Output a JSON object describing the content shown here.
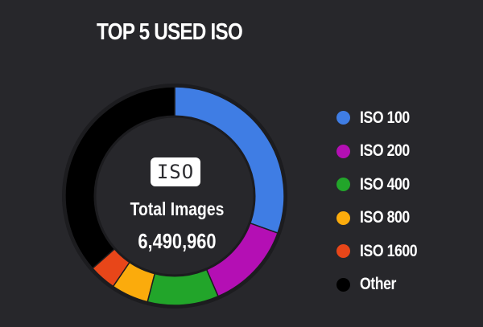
{
  "chart_data": {
    "type": "pie",
    "title": "TOP 5 USED ISO",
    "center_badge": "ISO",
    "center_label": "Total Images",
    "center_value": "6,490,960",
    "legend_position": "right",
    "categories": [
      "ISO 100",
      "ISO 200",
      "ISO 400",
      "ISO 800",
      "ISO 1600",
      "Other"
    ],
    "values": [
      30.5,
      13.0,
      10.5,
      5.5,
      4.0,
      36.5
    ],
    "colors": [
      "#3f7de4",
      "#b40fb4",
      "#22a52a",
      "#fbab0c",
      "#e84619",
      "#000000"
    ]
  }
}
